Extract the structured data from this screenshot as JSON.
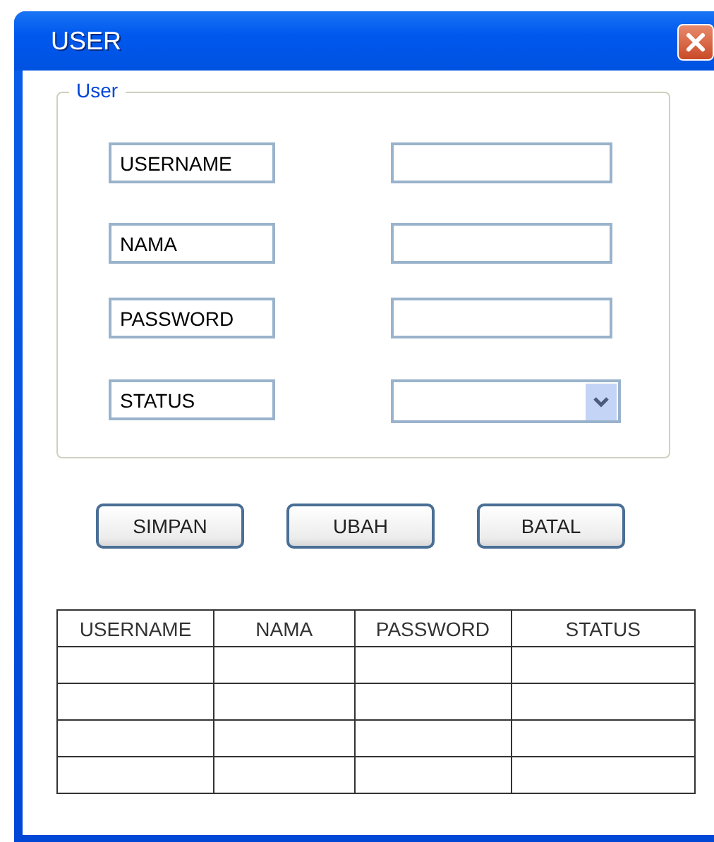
{
  "window": {
    "title": "USER"
  },
  "group": {
    "title": "User"
  },
  "fields": [
    {
      "label": "USERNAME",
      "kind": "text"
    },
    {
      "label": "NAMA",
      "kind": "text"
    },
    {
      "label": "PASSWORD",
      "kind": "text"
    },
    {
      "label": "STATUS",
      "kind": "select"
    }
  ],
  "buttons": [
    "SIMPAN",
    "UBAH",
    "BATAL"
  ],
  "table": {
    "columns": [
      "USERNAME",
      "NAMA",
      "PASSWORD",
      "STATUS"
    ],
    "rows": [
      {
        "kind": "blank"
      },
      {
        "kind": "blank"
      },
      {
        "kind": "blank"
      },
      {
        "kind": "blank"
      }
    ]
  }
}
